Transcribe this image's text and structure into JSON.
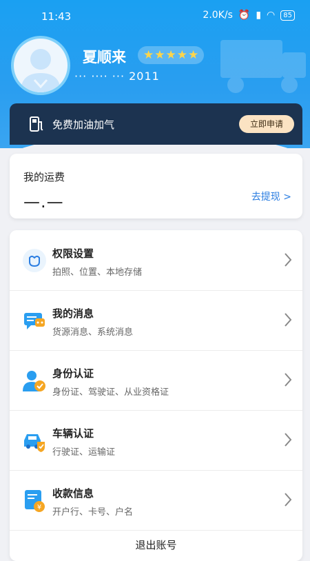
{
  "status_bar": {
    "time": "11:43",
    "speed": "2.0K/s",
    "battery": "85"
  },
  "profile": {
    "name": "夏顺来",
    "rating": 5,
    "phone": "··· ···· ··· 2011"
  },
  "fuel": {
    "label": "免费加油加气",
    "button": "立即申请"
  },
  "fee": {
    "title": "我的运费",
    "value": "—.—",
    "withdraw": "去提现 >"
  },
  "menu": [
    {
      "title": "权限设置",
      "subtitle": "拍照、位置、本地存储",
      "icon": "permission-icon"
    },
    {
      "title": "我的消息",
      "subtitle": "货源消息、系统消息",
      "icon": "message-icon"
    },
    {
      "title": "身份认证",
      "subtitle": "身份证、驾驶证、从业资格证",
      "icon": "identity-icon"
    },
    {
      "title": "车辆认证",
      "subtitle": "行驶证、运输证",
      "icon": "vehicle-icon"
    },
    {
      "title": "收款信息",
      "subtitle": "开户行、卡号、户名",
      "icon": "payment-icon"
    }
  ],
  "logout": "退出账号",
  "colors": {
    "primary": "#1aa0f2",
    "dark_card": "#1c3350",
    "link": "#2a7de1",
    "accent_orange": "#f5a623"
  }
}
